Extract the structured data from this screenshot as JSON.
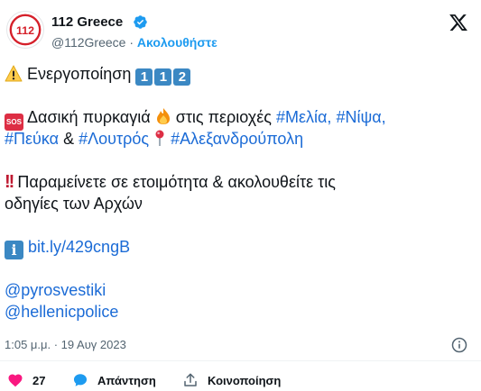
{
  "account": {
    "name": "112 Greece",
    "handle": "@112Greece",
    "separator": "·",
    "follow_label": "Ακολουθήστε",
    "avatar_text": "112",
    "avatar_color": "#d5202a"
  },
  "post": {
    "line1_text": "Ενεργοποίηση",
    "line1_digits": [
      "1",
      "1",
      "2"
    ],
    "line2_text": "Δασική πυρκαγιά",
    "line2_mid": "στις περιοχές",
    "line2_tags": [
      "#Μελία,",
      "#Νίψα,"
    ],
    "line3_tag1": "#Πεύκα",
    "line3_amp": "&",
    "line3_tag2": "#Λουτρός",
    "line3_tag3": "#Αλεξανδρούπολη",
    "line4_text": "Παραμείνετε σε ετοιμότητα  & ακολουθείτε τις",
    "line5_text": "οδηγίες των Αρχών",
    "link": "bit.ly/429cngB",
    "mention1": "@pyrosvestiki",
    "mention2": "@hellenicpolice",
    "sos_label": "SOS",
    "info_label": "i",
    "icons": [
      "warning-icon",
      "keycap-digit-icon",
      "sos-icon",
      "fire-icon",
      "round-pushpin-icon",
      "double-exclamation-icon",
      "information-icon"
    ]
  },
  "meta": {
    "timestamp": "1:05 μ.μ. · 19 Αυγ 2023"
  },
  "actions": {
    "likes": "27",
    "reply_label": "Απάντηση",
    "share_label": "Κοινοποίηση"
  },
  "colors": {
    "link": "#1b6bd6",
    "follow": "#1d9bf0",
    "like": "#f91880",
    "reply": "#1d9bf0",
    "muted": "#536471"
  }
}
